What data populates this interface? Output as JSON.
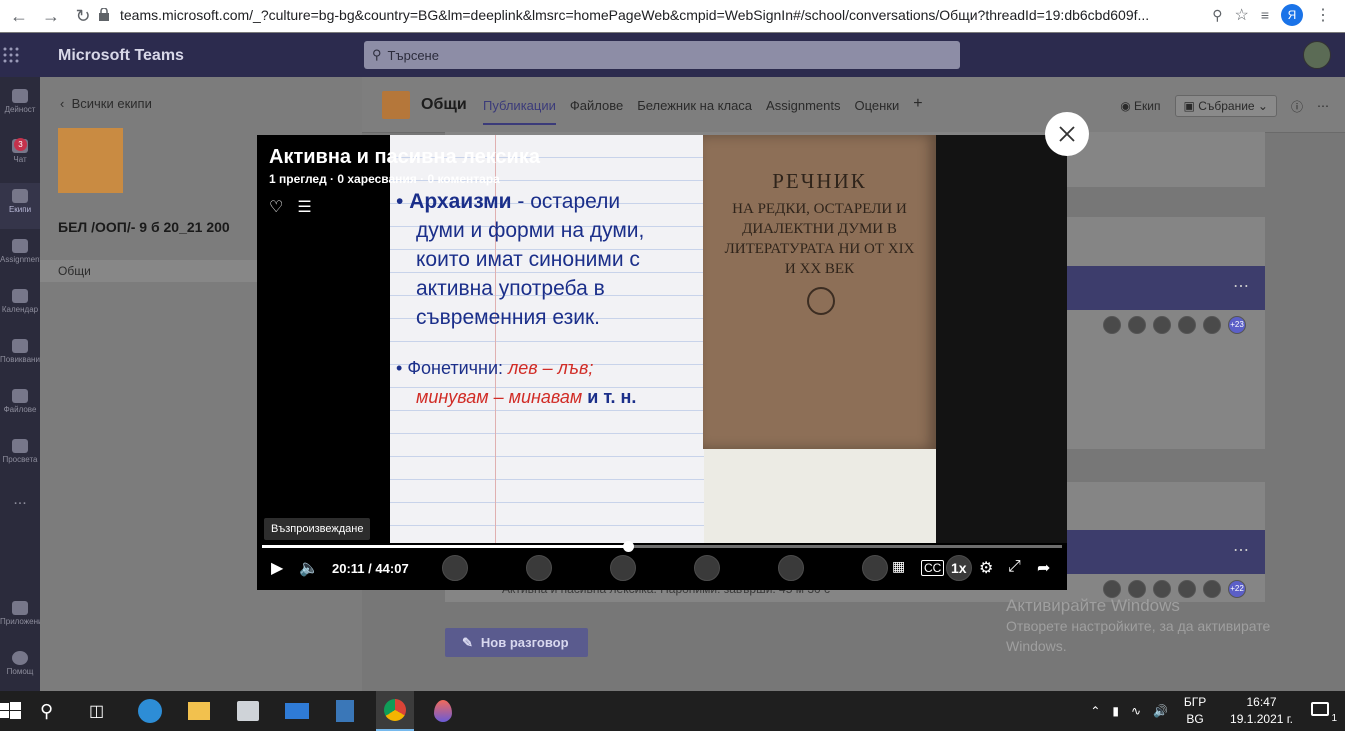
{
  "browser": {
    "url": "teams.microsoft.com/_?culture=bg-bg&country=BG&lm=deeplink&lmsrc=homePageWeb&cmpid=WebSignIn#/school/conversations/Общи?threadId=19:db6cbd609f...",
    "profile_initial": "Я"
  },
  "teams": {
    "app_title": "Microsoft Teams",
    "search_placeholder": "Търсене"
  },
  "rail": {
    "items": [
      {
        "label": "Дейност"
      },
      {
        "label": "Чат",
        "badge": "3"
      },
      {
        "label": "Екипи"
      },
      {
        "label": "Assignments"
      },
      {
        "label": "Календар"
      },
      {
        "label": "Повиквания"
      },
      {
        "label": "Файлове"
      },
      {
        "label": "Просвета"
      },
      {
        "label": "..."
      },
      {
        "label": "Приложения"
      },
      {
        "label": "Помощ"
      }
    ]
  },
  "team_panel": {
    "back_label": "Всички екипи",
    "team_name": "БЕЛ /ООП/- 9 б 20_21 200",
    "channel": "Общи"
  },
  "channel_header": {
    "title": "Общи",
    "tabs": [
      "Публикации",
      "Файлове",
      "Бележник на класа",
      "Assignments",
      "Оценки"
    ],
    "team_label": "Екип",
    "meeting_label": "Събрание"
  },
  "posts": {
    "avatar_more_1": "+23",
    "avatar_more_2": "+22",
    "meeting_line": "Активна и пасивна лексика. Пароними. завърши: 45 м 30 с",
    "new_chat_label": "Нов разговор"
  },
  "video": {
    "title": "Активна и пасивна лексика",
    "meta": "1 преглед · 0 харесвания · 0 коментара",
    "slide_line1_bold": "Архаизми",
    "slide_line1_rest": " - остарели",
    "slide_line2": "думи и форми на думи,",
    "slide_line3": "които имат синоними с",
    "slide_line4": "активна употреба в",
    "slide_line5": "съвременния език.",
    "slide_line6_label": "Фонетични: ",
    "slide_line6_red": "лев – лъв;",
    "slide_line7_red": "минувам – минавам",
    "slide_line7_rest": " и т. н.",
    "book_heading": "РЕЧНИК",
    "book_sub": "НА РЕДКИ, ОСТАРЕЛИ И ДИАЛЕКТНИ ДУМИ В ЛИТЕРАТУРАТА НИ ОТ XIX И XX ВЕК",
    "tooltip": "Възпроизвеждане",
    "current_time": "20:11",
    "separator": "/",
    "total_time": "44:07",
    "progress_fraction": 0.457,
    "speed": "1x"
  },
  "watermark": {
    "line1": "Активирайте Windows",
    "line2": "Отворете настройките, за да активирате",
    "line3": "Windows."
  },
  "taskbar": {
    "lang_top": "БГР",
    "lang_bottom": "BG",
    "time": "16:47",
    "date": "19.1.2021 г.",
    "notification_count": "1"
  },
  "colors": {
    "teams_header": "#2c2b4e",
    "accent": "#5b5fc7",
    "taskbar": "#1f1f1f"
  }
}
